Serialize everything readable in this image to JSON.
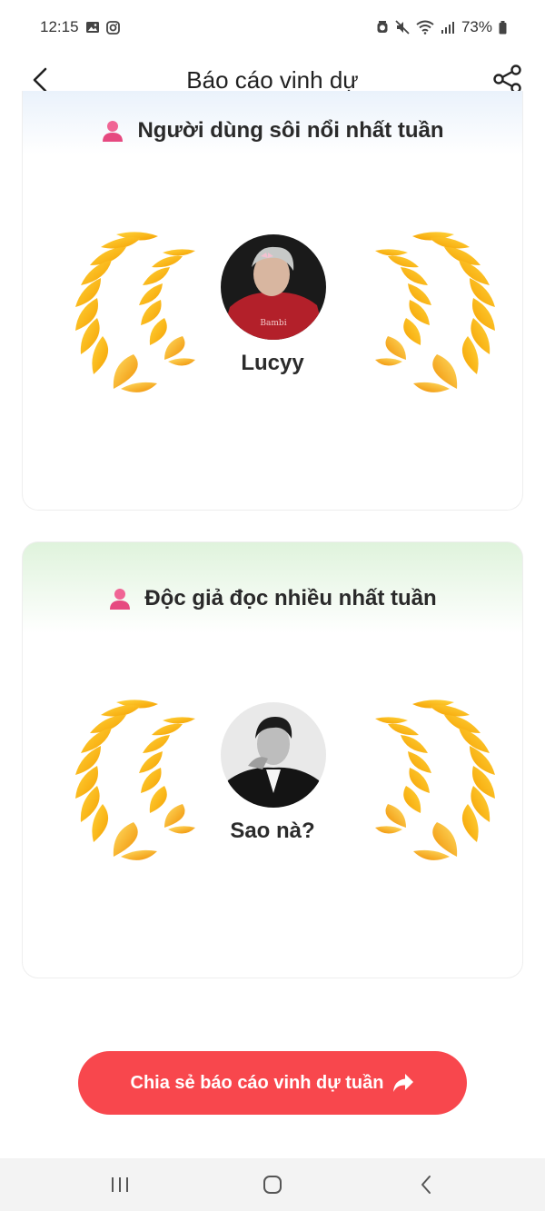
{
  "status_bar": {
    "time": "12:15",
    "battery": "73%",
    "icons": [
      "gallery-icon",
      "instagram-icon",
      "alarm-icon",
      "mute-icon",
      "wifi-icon",
      "signal-icon",
      "battery-icon"
    ]
  },
  "header": {
    "title": "Báo cáo vinh dự",
    "back_icon": "chevron-left-icon",
    "share_icon": "share-icon"
  },
  "cards": [
    {
      "heading": "Người dùng sôi nổi nhất tuần",
      "winner_name": "Lucyy",
      "accent": "#eaf2fb"
    },
    {
      "heading": "Độc giả đọc nhiều nhất tuần",
      "winner_name": "Sao nà?",
      "accent": "#dff3dc"
    }
  ],
  "share_button": {
    "label": "Chia sẻ báo cáo vinh dự tuần",
    "icon": "forward-arrow-icon",
    "color": "#f8474d"
  },
  "nav_bar": {
    "recents_icon": "recents-icon",
    "home_icon": "home-icon",
    "back_icon": "back-icon"
  }
}
